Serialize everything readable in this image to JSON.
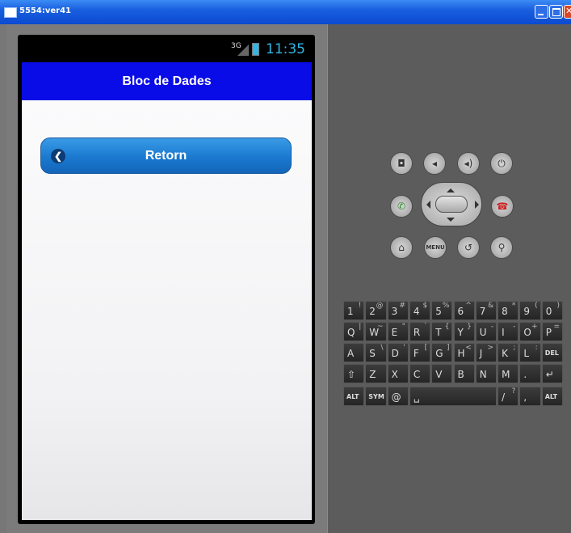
{
  "window": {
    "title": "5554:ver41"
  },
  "statusbar": {
    "network": "3G",
    "time": "11:35"
  },
  "app": {
    "title": "Bloc de Dades",
    "back_label": "Retorn"
  },
  "hardware_buttons": [
    "camera-icon",
    "volume-down-icon",
    "volume-up-icon",
    "power-icon",
    "call-icon",
    "end-call-icon",
    "home-icon",
    "menu-icon",
    "back-icon",
    "search-icon"
  ],
  "hardware": {
    "menu_label": "MENU"
  },
  "keyboard": {
    "rows": [
      [
        {
          "k": "1",
          "s": "!"
        },
        {
          "k": "2",
          "s": "@"
        },
        {
          "k": "3",
          "s": "#"
        },
        {
          "k": "4",
          "s": "$"
        },
        {
          "k": "5",
          "s": "%"
        },
        {
          "k": "6",
          "s": "^"
        },
        {
          "k": "7",
          "s": "&"
        },
        {
          "k": "8",
          "s": "*"
        },
        {
          "k": "9",
          "s": "("
        },
        {
          "k": "0",
          "s": ")"
        }
      ],
      [
        {
          "k": "Q",
          "s": "|"
        },
        {
          "k": "W",
          "s": "~"
        },
        {
          "k": "E",
          "s": "\""
        },
        {
          "k": "R",
          "s": "`"
        },
        {
          "k": "T",
          "s": "{"
        },
        {
          "k": "Y",
          "s": "}"
        },
        {
          "k": "U",
          "s": "-"
        },
        {
          "k": "I",
          "s": "-"
        },
        {
          "k": "O",
          "s": "+"
        },
        {
          "k": "P",
          "s": "="
        }
      ],
      [
        {
          "k": "A",
          "s": ""
        },
        {
          "k": "S",
          "s": "\\"
        },
        {
          "k": "D",
          "s": "'"
        },
        {
          "k": "F",
          "s": "["
        },
        {
          "k": "G",
          "s": "]"
        },
        {
          "k": "H",
          "s": "<"
        },
        {
          "k": "J",
          "s": ">"
        },
        {
          "k": "K",
          "s": ";"
        },
        {
          "k": "L",
          "s": ":"
        },
        {
          "k": "DEL",
          "s": ""
        }
      ],
      [
        {
          "k": "⇧",
          "s": ""
        },
        {
          "k": "Z",
          "s": ""
        },
        {
          "k": "X",
          "s": ""
        },
        {
          "k": "C",
          "s": ""
        },
        {
          "k": "V",
          "s": ""
        },
        {
          "k": "B",
          "s": ""
        },
        {
          "k": "N",
          "s": ""
        },
        {
          "k": "M",
          "s": ""
        },
        {
          "k": ".",
          "s": ""
        },
        {
          "k": "↵",
          "s": ""
        }
      ],
      [
        {
          "k": "ALT",
          "s": ""
        },
        {
          "k": "SYM",
          "s": ""
        },
        {
          "k": "@",
          "s": ""
        },
        {
          "k": "␣",
          "s": ""
        },
        {
          "k": "/",
          "s": "?"
        },
        {
          "k": ",",
          "s": ""
        },
        {
          "k": "ALT",
          "s": ""
        }
      ]
    ]
  }
}
